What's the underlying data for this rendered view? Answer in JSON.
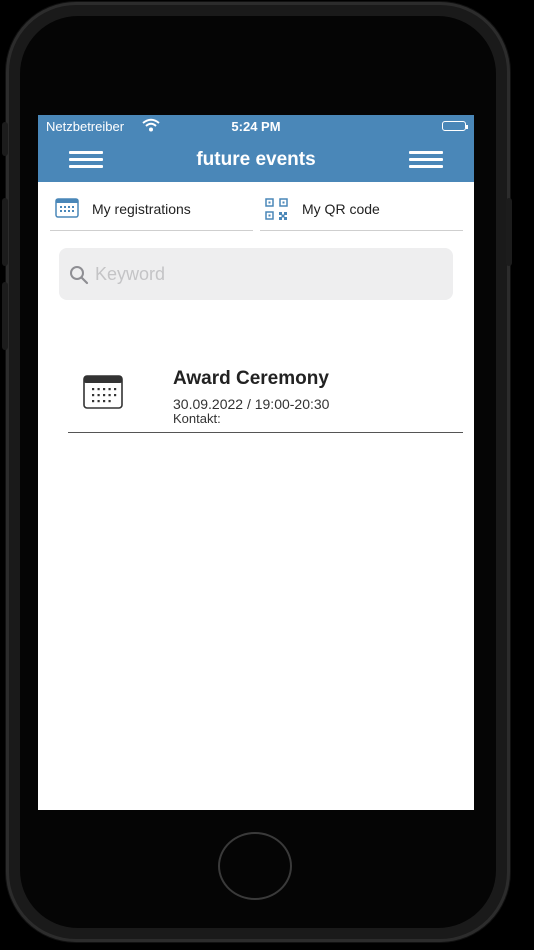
{
  "status_bar": {
    "carrier": "Netzbetreiber",
    "time": "5:24 PM"
  },
  "nav_bar": {
    "title": "future events",
    "left_icon": "hamburger-menu-icon",
    "right_icon": "hamburger-menu-icon",
    "color": "#4a87b8"
  },
  "tabs": [
    {
      "label": "My registrations",
      "icon": "calendar-icon"
    },
    {
      "label": "My QR code",
      "icon": "qr-code-icon"
    }
  ],
  "search": {
    "placeholder": "Keyword",
    "value": "",
    "icon": "search-icon"
  },
  "events": [
    {
      "title": "Award Ceremony",
      "date_time": "30.09.2022 / 19:00-20:30",
      "contact": "Kontakt:",
      "icon": "calendar-icon"
    }
  ]
}
